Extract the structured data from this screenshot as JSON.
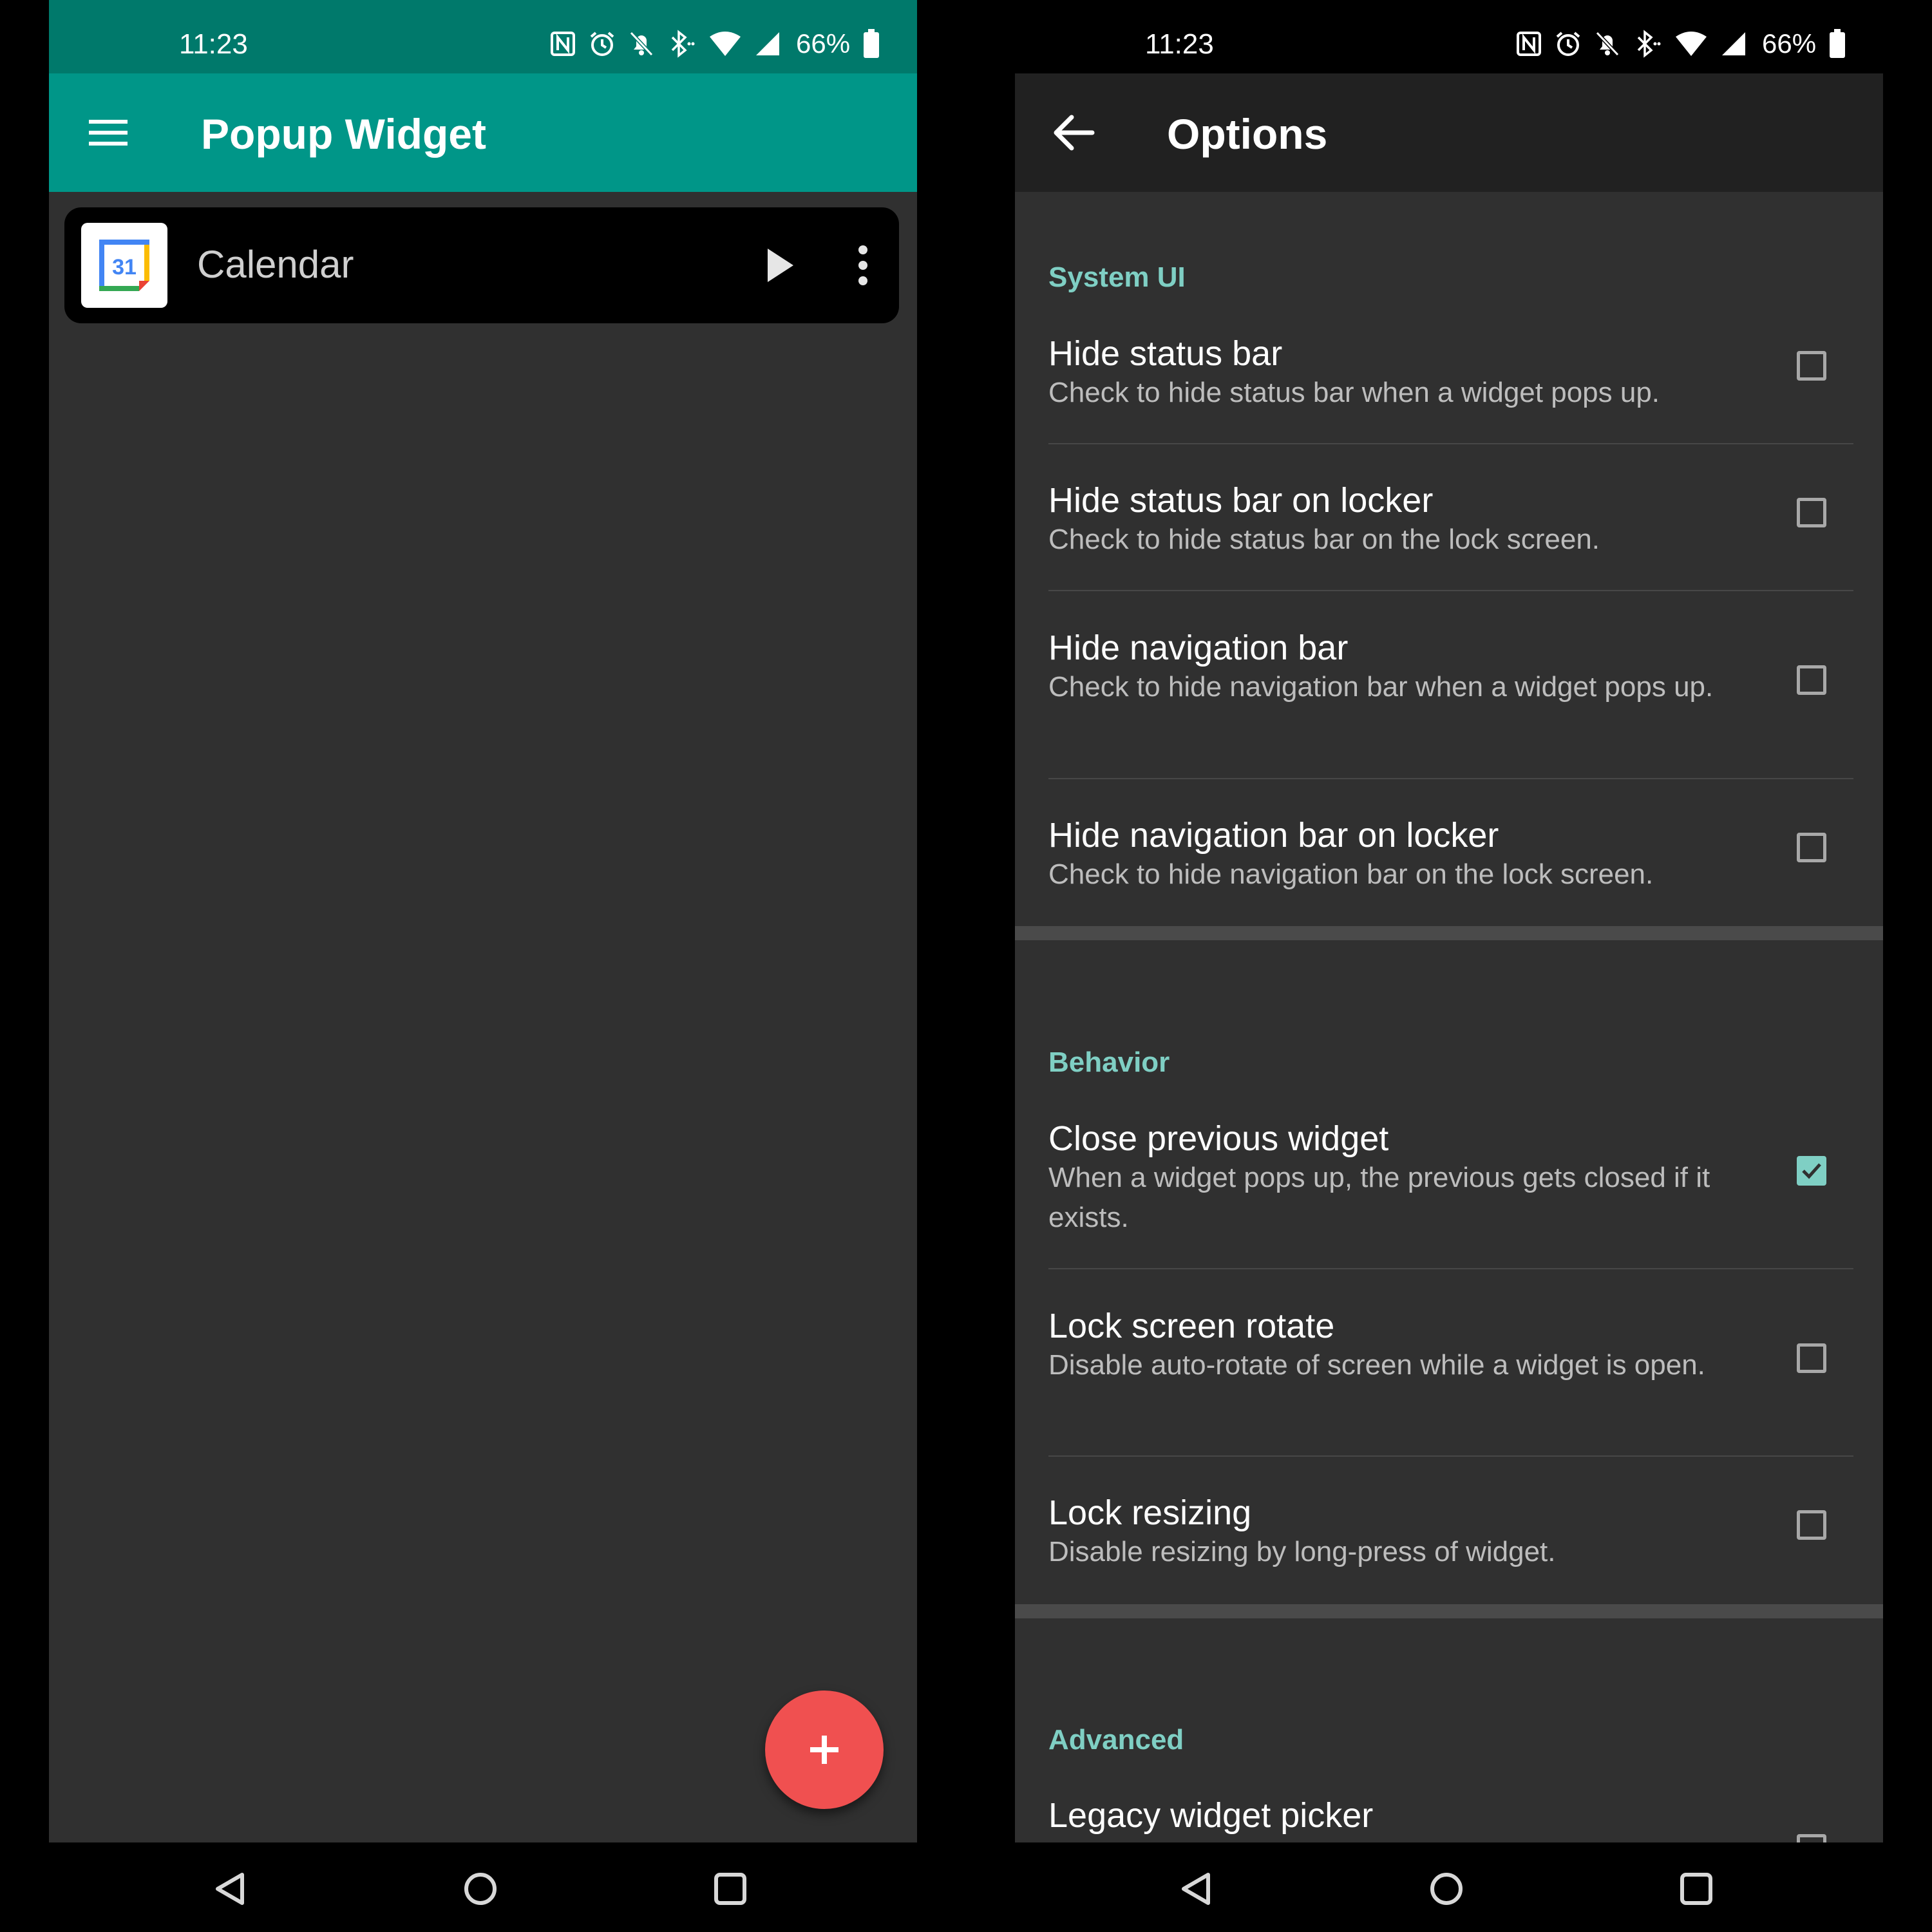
{
  "colors": {
    "teal": "#009688",
    "teal_accent": "#7fcfc4",
    "fab_red": "#f05050",
    "panel_bg": "#303030"
  },
  "left": {
    "status": {
      "time": "11:23",
      "battery": "66%",
      "icons": [
        "nfc-icon",
        "alarm-icon",
        "mute-icon",
        "bluetooth-icon",
        "wifi-icon",
        "signal-icon",
        "battery-icon"
      ]
    },
    "appbar": {
      "title": "Popup Widget",
      "menu_icon": "hamburger-menu-icon"
    },
    "widgets": [
      {
        "name": "Calendar",
        "icon_text": "31"
      }
    ],
    "fab_icon": "plus-icon"
  },
  "right": {
    "status": {
      "time": "11:23",
      "battery": "66%"
    },
    "appbar": {
      "title": "Options",
      "back_icon": "arrow-back-icon"
    },
    "sections": [
      {
        "header": "System UI",
        "options": [
          {
            "title": "Hide status bar",
            "summary": "Check to hide status bar when a widget pops up.",
            "checked": false
          },
          {
            "title": "Hide status bar on locker",
            "summary": "Check to hide status bar on the lock screen.",
            "checked": false
          },
          {
            "title": "Hide navigation bar",
            "summary": "Check to hide navigation bar when a widget pops up.",
            "checked": false
          },
          {
            "title": "Hide navigation bar on locker",
            "summary": "Check to hide navigation bar on the lock screen.",
            "checked": false
          }
        ]
      },
      {
        "header": "Behavior",
        "options": [
          {
            "title": "Close previous widget",
            "summary": "When a widget pops up, the previous gets closed if it exists.",
            "checked": true
          },
          {
            "title": "Lock screen rotate",
            "summary": "Disable auto-rotate of screen while a widget is open.",
            "checked": false
          },
          {
            "title": "Lock resizing",
            "summary": "Disable resizing by long-press of widget.",
            "checked": false
          }
        ]
      },
      {
        "header": "Advanced",
        "options": [
          {
            "title": "Legacy widget picker",
            "summary": "",
            "checked": false
          }
        ]
      }
    ]
  },
  "navbar": {
    "buttons": [
      "nav-back-icon",
      "nav-home-icon",
      "nav-recents-icon"
    ]
  }
}
